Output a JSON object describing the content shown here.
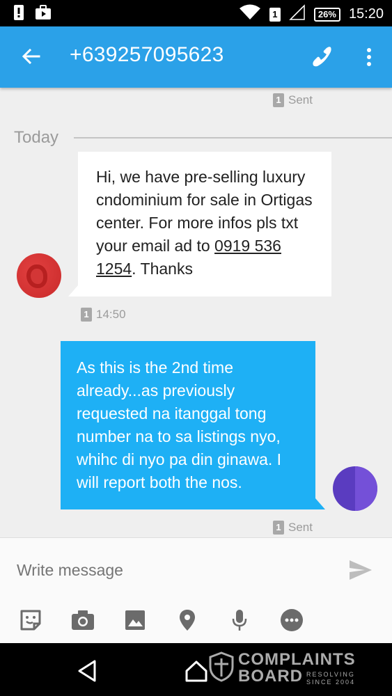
{
  "status_bar": {
    "sim_slot": "1",
    "battery": "26%",
    "time": "15:20"
  },
  "app_bar": {
    "title": "+639257095623"
  },
  "conversation": {
    "previous_sent": {
      "sim": "1",
      "status": "Sent"
    },
    "date_divider": "Today",
    "incoming": {
      "text_before_link": "Hi, we have pre-selling luxury cndominium for sale in Ortigas center. For more infos pls txt your email ad to ",
      "phone_link": "0919 536 1254",
      "text_after_link": ". Thanks",
      "sim": "1",
      "time": "14:50"
    },
    "outgoing": {
      "text": "As this is the 2nd time already...as previously requested na itanggal tong number na to sa listings nyo, whihc di nyo pa din ginawa. I will report both the nos.",
      "sim": "1",
      "status": "Sent"
    }
  },
  "compose": {
    "placeholder": "Write message"
  },
  "watermark": {
    "line1": "COMPLAINTS",
    "line2": "BOARD",
    "line3": "RESOLVING",
    "line4": "SINCE 2004"
  },
  "colors": {
    "app_bar": "#2ba1e8",
    "outgoing_bubble": "#1eb0f5",
    "incoming_bubble": "#ffffff",
    "background": "#efefef"
  }
}
